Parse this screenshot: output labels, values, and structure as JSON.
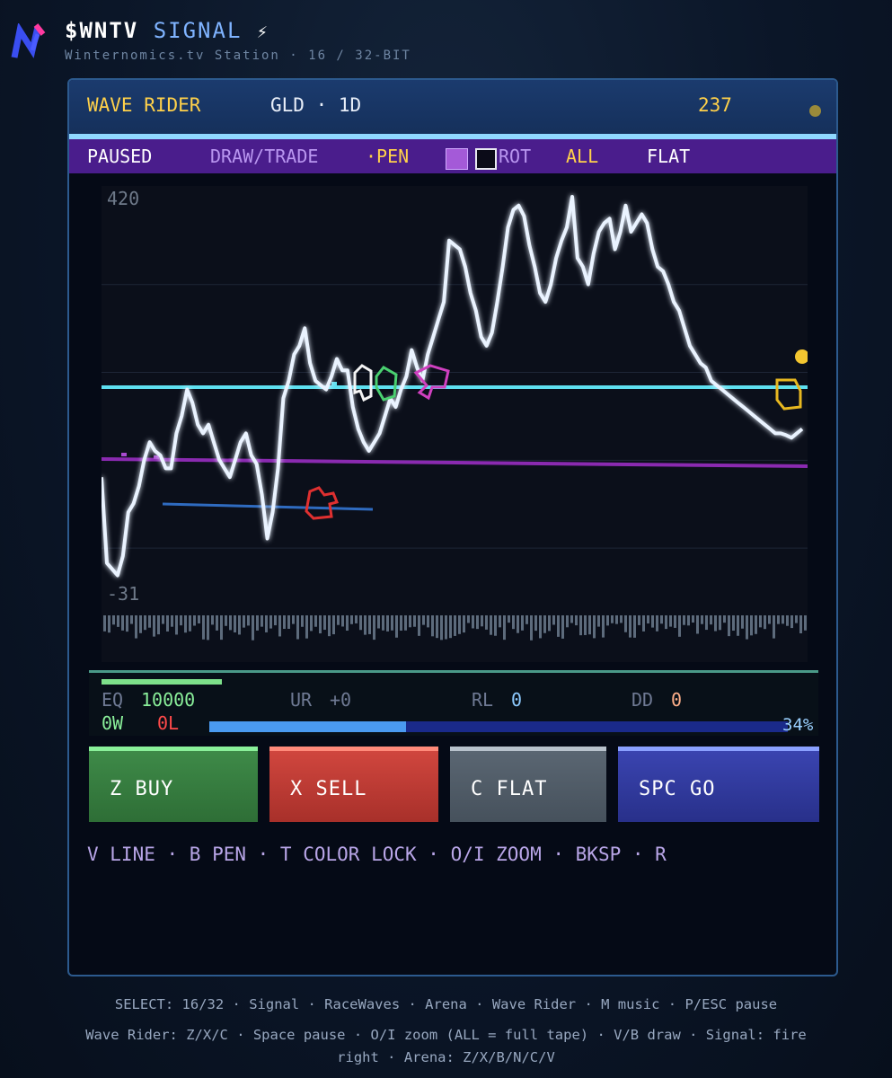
{
  "header": {
    "ticker": "$WNTV",
    "title": "SIGNAL",
    "bolt": "⚡",
    "subtitle": "Winternomics.tv Station · 16 / 32-BIT",
    "logo": "N"
  },
  "game": {
    "mode": "WAVE RIDER",
    "symbol": "GLD · 1D",
    "counter": "237",
    "colors": {
      "accent_yellow": "#ffd14a",
      "toolbar": "#4a1d8c",
      "price_line": "#e8f2ff",
      "cyan_line": "#5ee0f0",
      "purple_line": "#8a2ab0",
      "blue_line": "#2f6bc0"
    }
  },
  "toolbar": {
    "paused": "PAUSED",
    "draw_trade": "DRAW/TRADE",
    "pen": "·PEN",
    "rot": "ROT",
    "all": "ALL",
    "flat": "FLAT",
    "swatch_color": "#a45ad8"
  },
  "chart_data": {
    "type": "line",
    "y_max_label": "420",
    "y_min_label": "-31",
    "ylim": [
      -31,
      420
    ],
    "grid": true,
    "price": [
      100,
      2,
      -5,
      -12,
      10,
      60,
      70,
      90,
      120,
      140,
      130,
      125,
      110,
      110,
      150,
      170,
      200,
      185,
      160,
      150,
      160,
      140,
      120,
      110,
      100,
      120,
      140,
      150,
      125,
      115,
      80,
      30,
      60,
      110,
      190,
      210,
      240,
      250,
      270,
      230,
      210,
      205,
      200,
      215,
      235,
      222,
      222,
      180,
      155,
      140,
      130,
      140,
      150,
      170,
      190,
      180,
      200,
      215,
      245,
      225,
      210,
      240,
      260,
      280,
      300,
      370,
      365,
      360,
      340,
      310,
      290,
      260,
      250,
      265,
      300,
      340,
      385,
      405,
      410,
      398,
      365,
      340,
      310,
      300,
      320,
      350,
      370,
      385,
      420,
      350,
      340,
      320,
      355,
      380,
      390,
      395,
      360,
      380,
      410,
      380,
      390,
      400,
      390,
      360,
      340,
      335,
      320,
      300,
      290,
      270,
      250,
      240,
      230,
      225,
      210,
      205,
      200,
      195,
      190,
      185,
      180,
      175,
      170,
      165,
      160,
      155,
      150,
      150,
      148,
      145,
      150,
      155
    ],
    "annotations": [
      "cyan support line",
      "purple trend line",
      "blue trend line",
      "red marker",
      "white marker",
      "green marker",
      "magenta marker",
      "yellow marker"
    ],
    "volume_bars": true
  },
  "stats": {
    "eq_label": "EQ",
    "eq_value": "10000",
    "ur_label": "UR",
    "ur_value": "+0",
    "rl_label": "RL",
    "rl_value": "0",
    "dd_label": "DD",
    "dd_value": "0",
    "wins": "0W",
    "losses": "0L",
    "progress_pct": "34%",
    "progress_fraction": 0.34
  },
  "buttons": {
    "buy": "Z BUY",
    "sell": "X SELL",
    "flat": "C FLAT",
    "go": "SPC GO"
  },
  "hotkeys": "V LINE · B PEN · T COLOR LOCK · O/I ZOOM · BKSP · R",
  "footer": {
    "line1": "SELECT: 16/32 · Signal · RaceWaves · Arena · Wave Rider · M music · P/ESC pause",
    "line2": "Wave Rider: Z/X/C · Space pause · O/I zoom (ALL = full tape) · V/B draw · Signal: fire",
    "line3": "right · Arena: Z/X/B/N/C/V"
  }
}
